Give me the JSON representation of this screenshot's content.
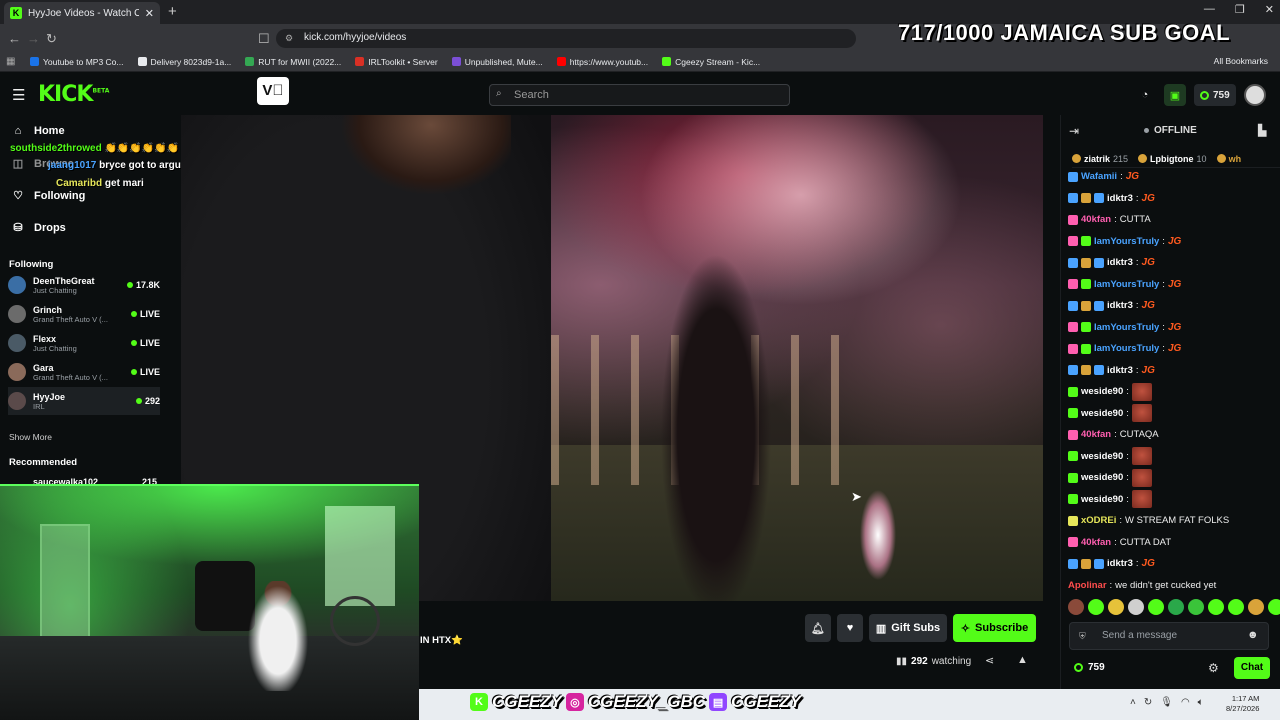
{
  "browser": {
    "tab_title": "HyyJoe Videos - Watch On-D",
    "url": "kick.com/hyyjoe/videos",
    "bookmarks": [
      {
        "label": "Youtube to MP3 Co...",
        "color": "#1a73e8"
      },
      {
        "label": "Delivery 8023d9-1a...",
        "color": "#e8eaed"
      },
      {
        "label": "RUT for MWII (2022...",
        "color": "#34a853"
      },
      {
        "label": "IRLToolkit • Server",
        "color": "#d93025"
      },
      {
        "label": "Unpublished, Mute...",
        "color": "#7b4fd6"
      },
      {
        "label": "https://www.youtub...",
        "color": "#ff0000"
      },
      {
        "label": "Cgeezy Stream - Kic...",
        "color": "#53fc18"
      }
    ],
    "all_bookmarks": "All Bookmarks"
  },
  "overlay": {
    "sub_goal": "717/1000 JAMAICA SUB GOAL",
    "sidebar_chat": [
      {
        "user": "southside2throwed",
        "text": "👏👏👏👏👏👏",
        "color": "#53fc18"
      },
      {
        "user": "jaang1017",
        "text": "bryce got to arguing w aj",
        "color": "#4aa3ff"
      },
      {
        "user": "Camaribd",
        "text": "get mari",
        "color": "#e6e65a"
      }
    ]
  },
  "kick": {
    "logo": "KICK",
    "logo_sup": "BETA",
    "search_placeholder": "Search",
    "kicks_balance": "759",
    "nav": [
      {
        "label": "Home",
        "icon": "home-icon"
      },
      {
        "label": "Browse",
        "icon": "browse-icon"
      },
      {
        "label": "Following",
        "icon": "heart-icon"
      },
      {
        "label": "Drops",
        "icon": "drops-icon"
      }
    ],
    "following_header": "Following",
    "following": [
      {
        "name": "DeenTheGreat",
        "category": "Just Chatting",
        "status": "17.8K",
        "color": "#3a6ea5"
      },
      {
        "name": "Grinch",
        "category": "Grand Theft Auto V (...",
        "status": "LIVE",
        "color": "#6b6b6b"
      },
      {
        "name": "Flexx",
        "category": "Just Chatting",
        "status": "LIVE",
        "color": "#4a5a66"
      },
      {
        "name": "Gara",
        "category": "Grand Theft Auto V (...",
        "status": "LIVE",
        "color": "#8a6a5a"
      },
      {
        "name": "HyyJoe",
        "category": "IRL",
        "status": "292",
        "color": "#5a4a4a"
      }
    ],
    "show_more": "Show More",
    "recommended_header": "Recommended",
    "recommended_partial": "saucewalka102",
    "recommended_partial_count": "215"
  },
  "stream": {
    "title": "IN HTX⭐",
    "gift_subs": "Gift Subs",
    "subscribe": "Subscribe",
    "watching_count": "292",
    "watching_label": "watching"
  },
  "chat": {
    "status": "OFFLINE",
    "leaders": [
      {
        "name": "ziatrik",
        "count": "215"
      },
      {
        "name": "Lpbigtone",
        "count": "10"
      },
      {
        "name": "wh",
        "count": ""
      }
    ],
    "messages": [
      {
        "user": "Wafamii",
        "color": "#4aa3ff",
        "text": "",
        "emote": "JG",
        "badges": [
          "#4aa3ff"
        ]
      },
      {
        "user": "idktr3",
        "color": "#ffffff",
        "text": "",
        "emote": "JG",
        "badges": [
          "#4aa3ff",
          "#d9a33a",
          "#4aa3ff"
        ]
      },
      {
        "user": "40kfan",
        "color": "#ff5fb0",
        "text": "CUTTA",
        "emote": "",
        "badges": [
          "#ff5fb0"
        ]
      },
      {
        "user": "IamYoursTruly",
        "color": "#4aa3ff",
        "text": "",
        "emote": "JG",
        "badges": [
          "#ff5fb0",
          "#53fc18"
        ]
      },
      {
        "user": "idktr3",
        "color": "#ffffff",
        "text": "",
        "emote": "JG",
        "badges": [
          "#4aa3ff",
          "#d9a33a",
          "#4aa3ff"
        ]
      },
      {
        "user": "IamYoursTruly",
        "color": "#4aa3ff",
        "text": "",
        "emote": "JG",
        "badges": [
          "#ff5fb0",
          "#53fc18"
        ]
      },
      {
        "user": "idktr3",
        "color": "#ffffff",
        "text": "",
        "emote": "JG",
        "badges": [
          "#4aa3ff",
          "#d9a33a",
          "#4aa3ff"
        ]
      },
      {
        "user": "IamYoursTruly",
        "color": "#4aa3ff",
        "text": "",
        "emote": "JG",
        "badges": [
          "#ff5fb0",
          "#53fc18"
        ]
      },
      {
        "user": "IamYoursTruly",
        "color": "#4aa3ff",
        "text": "",
        "emote": "JG",
        "badges": [
          "#ff5fb0",
          "#53fc18"
        ]
      },
      {
        "user": "idktr3",
        "color": "#ffffff",
        "text": "",
        "emote": "JG",
        "badges": [
          "#4aa3ff",
          "#d9a33a",
          "#4aa3ff"
        ]
      },
      {
        "user": "weside90",
        "color": "#ffffff",
        "text": "",
        "emote": "face",
        "badges": [
          "#53fc18"
        ]
      },
      {
        "user": "weside90",
        "color": "#ffffff",
        "text": "",
        "emote": "face",
        "badges": [
          "#53fc18"
        ]
      },
      {
        "user": "40kfan",
        "color": "#ff5fb0",
        "text": "CUTAQA",
        "emote": "",
        "badges": [
          "#ff5fb0"
        ]
      },
      {
        "user": "weside90",
        "color": "#ffffff",
        "text": "",
        "emote": "face",
        "badges": [
          "#53fc18"
        ]
      },
      {
        "user": "weside90",
        "color": "#ffffff",
        "text": "",
        "emote": "face",
        "badges": [
          "#53fc18"
        ]
      },
      {
        "user": "weside90",
        "color": "#ffffff",
        "text": "",
        "emote": "face",
        "badges": [
          "#53fc18"
        ]
      },
      {
        "user": "xODREi",
        "color": "#e6e65a",
        "text": "W STREAM FAT FOLKS",
        "emote": "",
        "badges": [
          "#e6e65a"
        ]
      },
      {
        "user": "40kfan",
        "color": "#ff5fb0",
        "text": "CUTTA DAT",
        "emote": "",
        "badges": [
          "#ff5fb0"
        ]
      },
      {
        "user": "idktr3",
        "color": "#ffffff",
        "text": "",
        "emote": "JG",
        "badges": [
          "#4aa3ff",
          "#d9a33a",
          "#4aa3ff"
        ]
      },
      {
        "user": "Apolinar",
        "color": "#ff4d4d",
        "text": "we didn't get cucked yet",
        "emote": "",
        "badges": []
      }
    ],
    "emote_colors": [
      "#8a4a3a",
      "#53fc18",
      "#e6c23a",
      "#cfcfcf",
      "#53fc18",
      "#2aa84a",
      "#3ac43a",
      "#53fc18",
      "#53fc18",
      "#d9a33a",
      "#53fc18"
    ],
    "input_placeholder": "Send a message",
    "points": "759",
    "chat_button": "Chat"
  },
  "streamer_overlay": {
    "socials": [
      {
        "handle": "CGEEZY",
        "icon": "kick-icon",
        "color": "#53fc18"
      },
      {
        "handle": "CGEEZY_GBC",
        "icon": "instagram-icon",
        "color": "#d6249f"
      },
      {
        "handle": "CGEEZY",
        "icon": "twitch-icon",
        "color": "#9146ff"
      }
    ]
  },
  "taskbar": {
    "time": "1:17 AM",
    "date": "8/27/2026"
  }
}
